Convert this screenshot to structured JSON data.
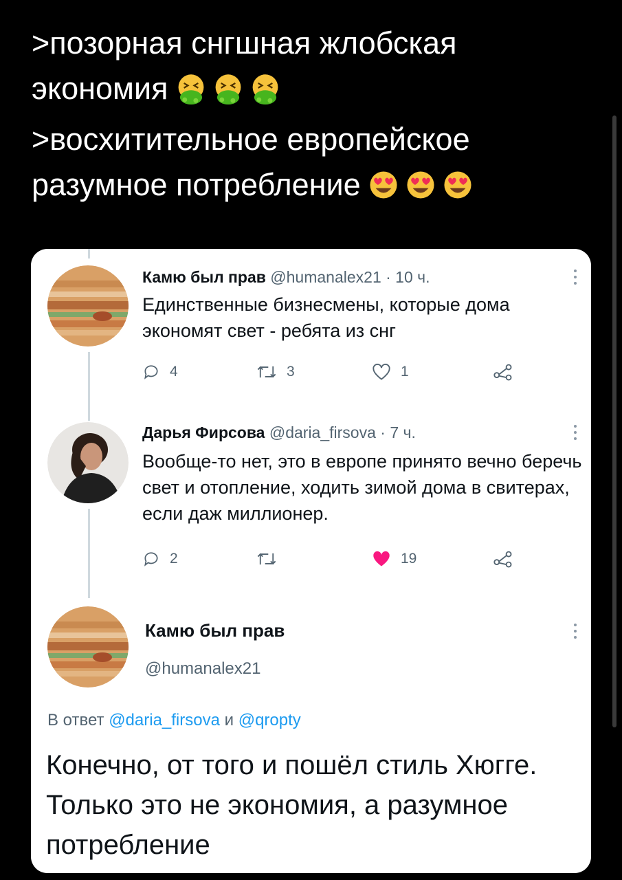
{
  "caption": {
    "line1": ">позорная снгшная жлобская",
    "line2": "экономия",
    "line2_emoji": "vomit-face-emoji x3",
    "line3": ">восхитительное европейское",
    "line4": "разумное потребление",
    "line4_emoji": "heart-eyes-emoji x3"
  },
  "tweets": [
    {
      "name": "Камю был прав",
      "handle": "@humanalex21",
      "time": "· 10 ч.",
      "text": "Единственные бизнесмены, которые дома экономят свет - ребята из снг",
      "replies": "4",
      "retweets": "3",
      "likes": "1",
      "liked": false
    },
    {
      "name": "Дарья Фирсова",
      "handle": "@daria_firsova",
      "time": "· 7 ч.",
      "text": "Вообще-то нет, это в европе принято вечно беречь свет и отопление, ходить зимой дома в свитерах, если даж миллионер.",
      "replies": "2",
      "retweets": "",
      "likes": "19",
      "liked": true
    }
  ],
  "main_tweet": {
    "name": "Камю был прав",
    "handle": "@humanalex21",
    "reply_prefix": "В ответ",
    "reply_user1": "@daria_firsova",
    "reply_and": "и",
    "reply_user2": "@qropty",
    "text": "Конечно, от того и пошёл стиль Хюгге. Только это не экономия, а разумное потребление"
  },
  "colors": {
    "background": "#000000",
    "card": "#ffffff",
    "text": "#0f1419",
    "muted": "#536471",
    "link": "#1d9bf0",
    "like": "#f91880"
  }
}
